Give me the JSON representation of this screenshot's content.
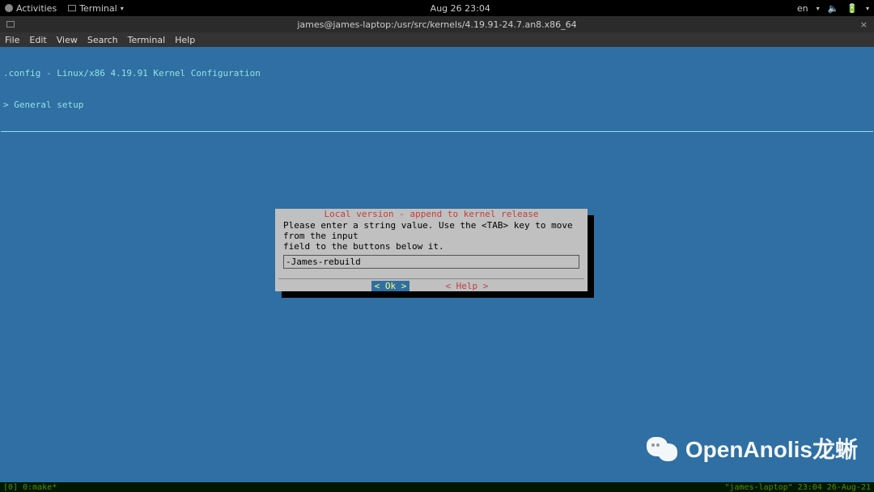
{
  "topbar": {
    "activities": "Activities",
    "app_name": "Terminal",
    "clock": "Aug 26  23:04",
    "lang": "en",
    "tray_dropdown": "▾"
  },
  "window": {
    "title": "james@james-laptop:/usr/src/kernels/4.19.91-24.7.an8.x86_64",
    "close": "×"
  },
  "menubar": {
    "items": [
      "File",
      "Edit",
      "View",
      "Search",
      "Terminal",
      "Help"
    ]
  },
  "config": {
    "line1": ".config - Linux/x86 4.19.91 Kernel Configuration",
    "line2": "> General setup"
  },
  "dialog": {
    "title": "Local version - append to kernel release",
    "instruction_l1": "Please enter a string value. Use the <TAB> key to move from the input",
    "instruction_l2": "field to the buttons below it.",
    "input_value": "-James-rebuild",
    "ok_label": "<  Ok  >",
    "help_label": "< Help >"
  },
  "status": {
    "left": "[0] 0:make*",
    "right": "\"james-laptop\" 23:04 26-Aug-21"
  },
  "watermark": {
    "text": "OpenAnolis龙蜥"
  }
}
